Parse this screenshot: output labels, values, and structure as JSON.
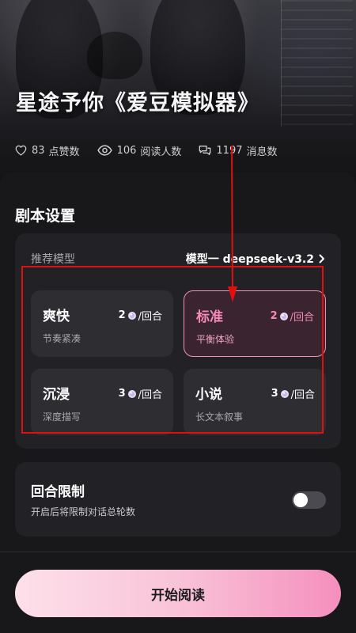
{
  "header": {
    "title": "星途予你《爱豆模拟器》",
    "stats": {
      "likes": {
        "count": "83",
        "label": "点赞数",
        "icon": "heart-icon"
      },
      "readers": {
        "count": "106",
        "label": "阅读人数",
        "icon": "eye-icon"
      },
      "messages": {
        "count": "1197",
        "label": "消息数",
        "icon": "chat-bubbles-icon"
      }
    }
  },
  "script_settings": {
    "title": "剧本设置",
    "recommended_model_label": "推荐模型",
    "recommended_model_value": "模型一 deepseek-v3.2",
    "options": [
      {
        "name": "爽快",
        "cost": "2",
        "unit": "/回合",
        "desc": "节奏紧凑",
        "selected": false
      },
      {
        "name": "标准",
        "cost": "2",
        "unit": "/回合",
        "desc": "平衡体验",
        "selected": true
      },
      {
        "name": "沉浸",
        "cost": "3",
        "unit": "/回合",
        "desc": "深度描写",
        "selected": false
      },
      {
        "name": "小说",
        "cost": "3",
        "unit": "/回合",
        "desc": "长文本叙事",
        "selected": false
      }
    ]
  },
  "round_limit": {
    "title": "回合限制",
    "desc": "开启后将限制对话总轮数",
    "enabled": false
  },
  "start_button": {
    "label": "开始阅读"
  },
  "colors": {
    "accent_pink": "#f58ab8",
    "annotation_red": "#e01010",
    "background": "#18181a",
    "card": "#222226"
  }
}
